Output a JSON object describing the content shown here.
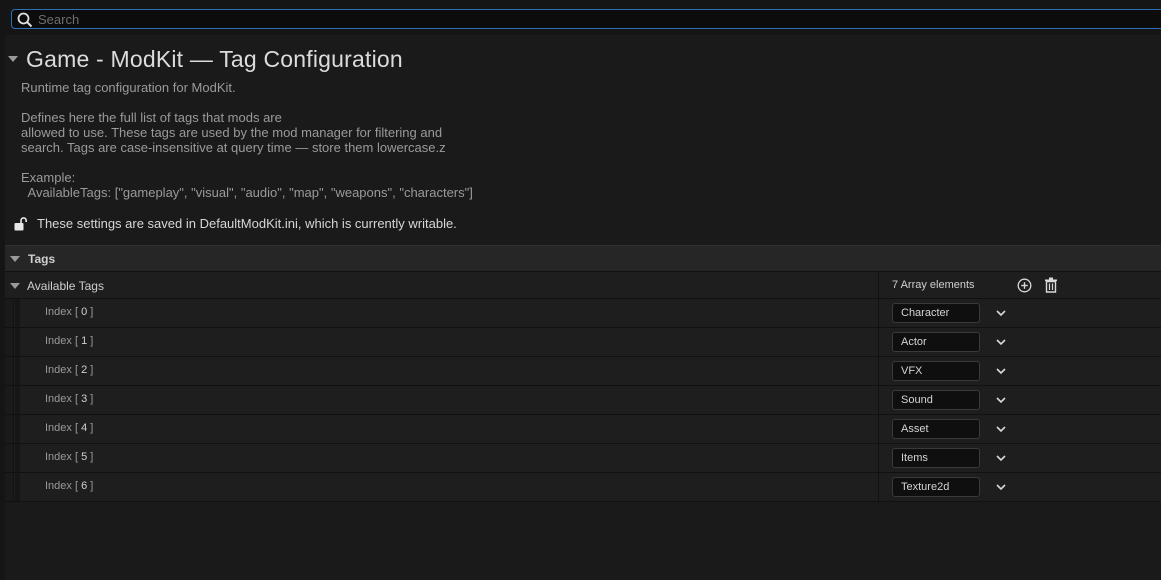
{
  "search": {
    "placeholder": "Search",
    "value": ""
  },
  "page": {
    "title": "Game - ModKit — Tag Configuration",
    "description_lines": [
      "Runtime tag configuration for ModKit.",
      "",
      "Defines here the full list of tags that mods are",
      "allowed to use. These tags are used by the mod manager for filtering and",
      "search. Tags are case-insensitive at query time — store them lowercase.z",
      "",
      "Example:",
      "  AvailableTags: [\"gameplay\", \"visual\", \"audio\", \"map\", \"weapons\", \"characters\"]"
    ],
    "notice": "These settings are saved in DefaultModKit.ini, which is currently writable."
  },
  "section": {
    "label": "Tags"
  },
  "array": {
    "label": "Available Tags",
    "count_text": "7 Array elements",
    "items": [
      {
        "index_prefix": "Index [ ",
        "index": "0",
        "index_suffix": " ]",
        "value": "Character"
      },
      {
        "index_prefix": "Index [ ",
        "index": "1",
        "index_suffix": " ]",
        "value": "Actor"
      },
      {
        "index_prefix": "Index [ ",
        "index": "2",
        "index_suffix": " ]",
        "value": "VFX"
      },
      {
        "index_prefix": "Index [ ",
        "index": "3",
        "index_suffix": " ]",
        "value": "Sound"
      },
      {
        "index_prefix": "Index [ ",
        "index": "4",
        "index_suffix": " ]",
        "value": "Asset"
      },
      {
        "index_prefix": "Index [ ",
        "index": "5",
        "index_suffix": " ]",
        "value": "Items"
      },
      {
        "index_prefix": "Index [ ",
        "index": "6",
        "index_suffix": " ]",
        "value": "Texture2d"
      }
    ]
  },
  "colors": {
    "accent": "#2b6fb8",
    "background": "#151515",
    "panel": "#1a1a1a",
    "row": "#1e1e1e"
  }
}
